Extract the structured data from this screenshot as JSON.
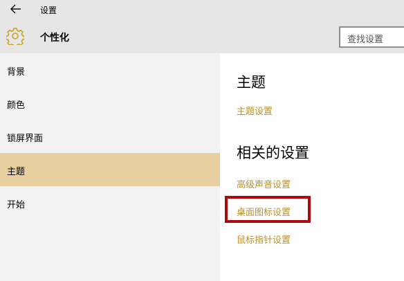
{
  "window": {
    "title": "设置"
  },
  "header": {
    "page_title": "个性化",
    "search_placeholder": "查找设置"
  },
  "sidebar": {
    "items": [
      {
        "label": "背景"
      },
      {
        "label": "颜色"
      },
      {
        "label": "锁屏界面"
      },
      {
        "label": "主题",
        "selected": true
      },
      {
        "label": "开始"
      }
    ]
  },
  "main": {
    "section_theme": {
      "heading": "主题",
      "link": "主题设置"
    },
    "section_related": {
      "heading": "相关的设置",
      "links": [
        "高级声音设置",
        "桌面图标设置",
        "鼠标指针设置"
      ]
    }
  },
  "colors": {
    "accent": "#b59132",
    "selected_bg": "#e8cf9f",
    "highlight": "#b0070b"
  },
  "icons": [
    "back-arrow-icon",
    "gear-icon"
  ]
}
